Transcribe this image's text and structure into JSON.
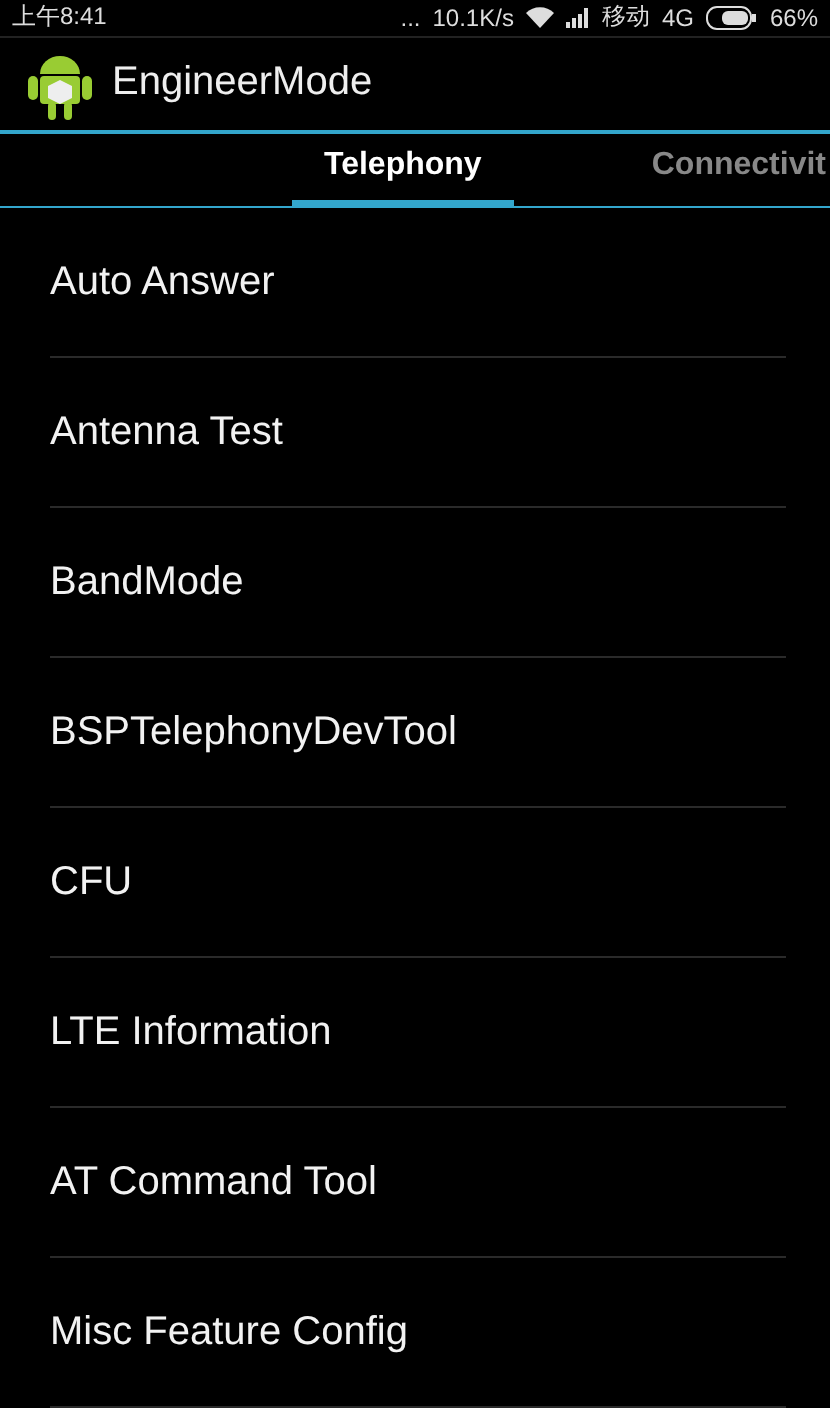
{
  "status_bar": {
    "time": "上午8:41",
    "dots": "...",
    "speed": "10.1K/s",
    "carrier": "移动",
    "network": "4G",
    "battery": "66%"
  },
  "app_bar": {
    "title": "EngineerMode"
  },
  "tabs": [
    {
      "label": "Telephony",
      "selected": true
    },
    {
      "label": "Connectivit",
      "selected": false
    }
  ],
  "items": [
    "Auto Answer",
    "Antenna Test",
    "BandMode",
    "BSPTelephonyDevTool",
    "CFU",
    "LTE Information",
    "AT Command Tool",
    "Misc Feature Config"
  ]
}
